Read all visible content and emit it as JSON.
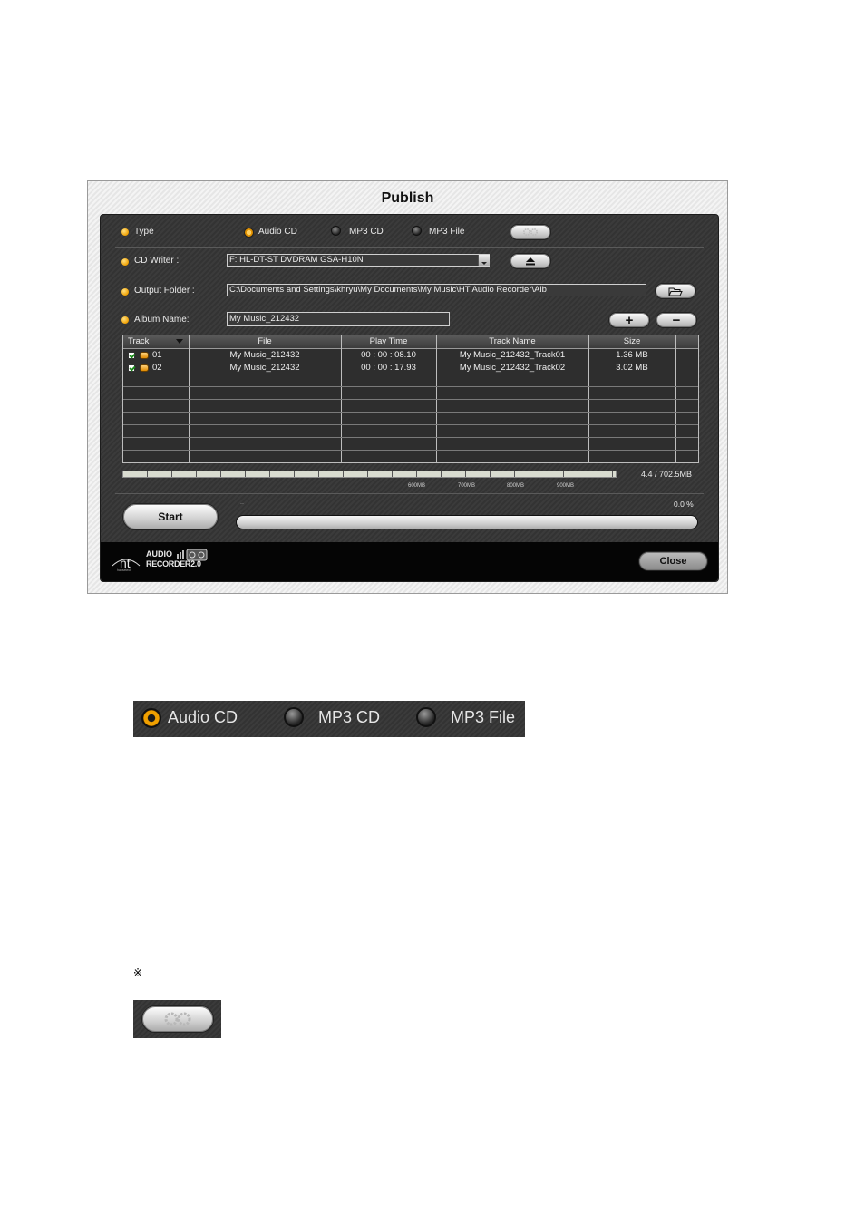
{
  "window": {
    "title": "Publish"
  },
  "type_row": {
    "label": "Type",
    "options": [
      {
        "label": "Audio CD",
        "selected": true
      },
      {
        "label": "MP3 CD",
        "selected": false
      },
      {
        "label": "MP3 File",
        "selected": false
      }
    ],
    "settings_icon": "gear-icon"
  },
  "cd_writer": {
    "label": "CD Writer :",
    "value": "F: HL-DT-ST DVDRAM GSA-H10N",
    "eject_icon": "eject-icon"
  },
  "output_folder": {
    "label": "Output  Folder :",
    "value": "C:\\Documents and Settings\\khryu\\My Documents\\My Music\\HT Audio Recorder\\Alb",
    "browse_icon": "folder-open-icon"
  },
  "album": {
    "label": "Album Name:",
    "value": "My Music_212432",
    "add_label": "+",
    "remove_label": "−"
  },
  "table": {
    "columns": [
      "Track",
      "File",
      "Play Time",
      "Track Name",
      "Size"
    ],
    "rows": [
      {
        "track": "01",
        "file": "My Music_212432",
        "play_time": "00 : 00 : 08.10",
        "track_name": "My Music_212432_Track01",
        "size": "1.36 MB"
      },
      {
        "track": "02",
        "file": "My Music_212432",
        "play_time": "00 : 00 : 17.93",
        "track_name": "My Music_212432_Track02",
        "size": "3.02 MB"
      }
    ]
  },
  "capacity": {
    "used_text": "4.4 / 702.5MB",
    "ticks": [
      "600MB",
      "700MB",
      "800MB",
      "900MB"
    ]
  },
  "progress": {
    "status": "..",
    "percent_text": "0.0 %",
    "value": 0
  },
  "start_label": "Start",
  "close_label": "Close",
  "logo": {
    "line1": "AUDIO",
    "line2": "RECORDER2.0",
    "small": "hansetech"
  },
  "zoom_type": {
    "options": [
      "Audio CD",
      "MP3 CD",
      "MP3 File"
    ]
  },
  "note_symbol": "※"
}
